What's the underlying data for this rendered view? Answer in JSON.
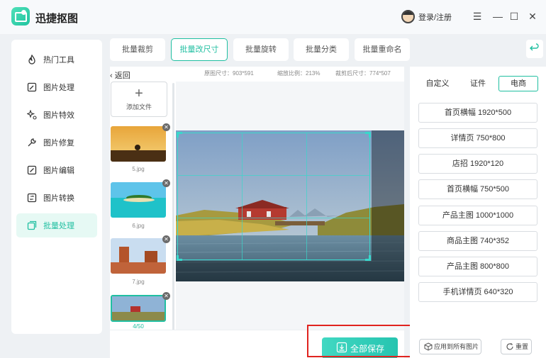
{
  "app": {
    "title": "迅捷抠图",
    "login_label": "登录/注册"
  },
  "window_controls": {
    "menu": "☰",
    "minimize": "—",
    "maximize": "☐",
    "close": "✕"
  },
  "sidebar": {
    "items": [
      {
        "label": "热门工具",
        "icon": "flame-icon"
      },
      {
        "label": "图片处理",
        "icon": "image-edit-icon"
      },
      {
        "label": "图片特效",
        "icon": "sparkle-icon"
      },
      {
        "label": "图片修复",
        "icon": "wrench-icon"
      },
      {
        "label": "图片编辑",
        "icon": "pencil-icon"
      },
      {
        "label": "图片转换",
        "icon": "convert-icon"
      },
      {
        "label": "批量处理",
        "icon": "batch-icon",
        "active": true
      }
    ]
  },
  "tabs": [
    {
      "label": "批量裁剪"
    },
    {
      "label": "批量改尺寸",
      "active": true
    },
    {
      "label": "批量旋转"
    },
    {
      "label": "批量分类"
    },
    {
      "label": "批量重命名"
    }
  ],
  "work": {
    "back_label": "返回",
    "original_size": "原图尺寸：903*591",
    "scale": "缩放比例：213%",
    "cropped_size": "裁剪后尺寸：774*507",
    "add_file_label": "添加文件",
    "thumbs": [
      {
        "name": "5.jpg"
      },
      {
        "name": "6.jpg"
      },
      {
        "name": "7.jpg"
      }
    ],
    "page_counter": "4/50",
    "save_all_label": "全部保存"
  },
  "presets": {
    "tabs": [
      {
        "label": "自定义"
      },
      {
        "label": "证件"
      },
      {
        "label": "电商",
        "active": true
      }
    ],
    "items": [
      "首页横幅 1920*500",
      "详情页 750*800",
      "店招 1920*120",
      "首页横幅 750*500",
      "产品主图 1000*1000",
      "商品主图 740*352",
      "产品主图 800*800",
      "手机详情页 640*320"
    ],
    "apply_all_label": "应用到所有图片",
    "reset_label": "重置"
  },
  "colors": {
    "accent": "#20bfa1",
    "highlight_box": "#e0231f"
  }
}
